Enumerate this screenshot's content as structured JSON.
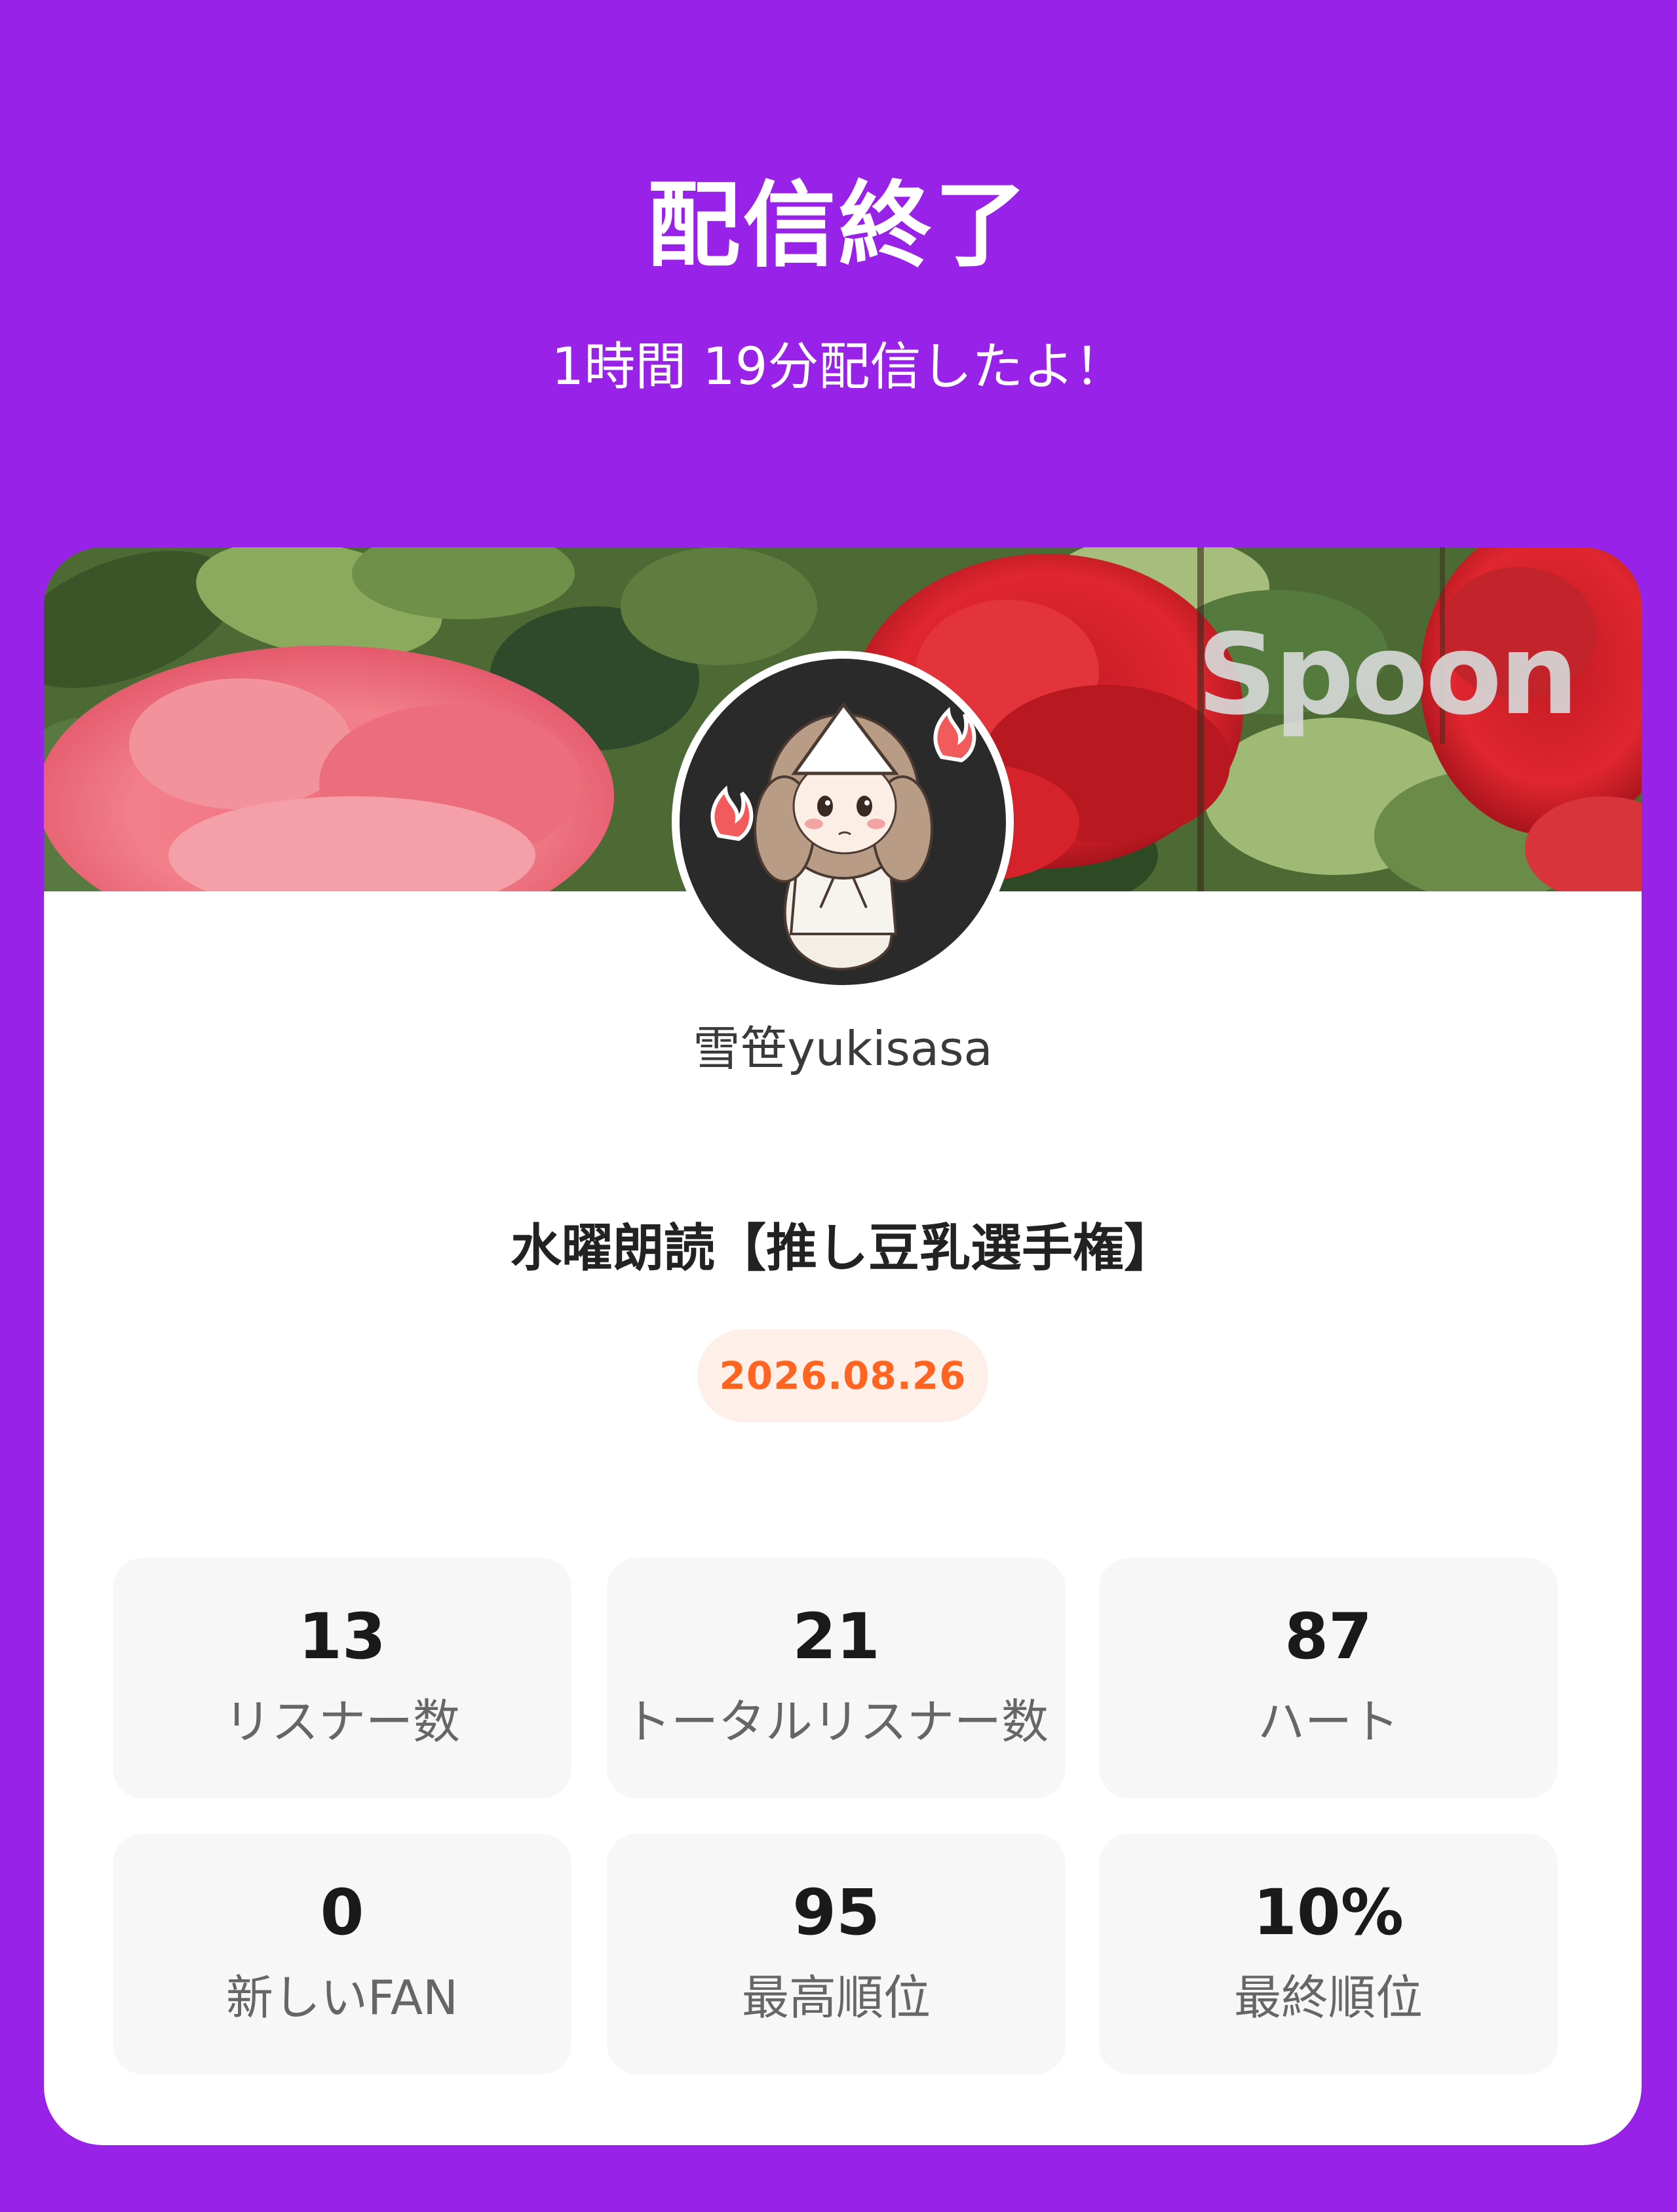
{
  "header": {
    "title": "配信終了",
    "subtitle": "1時間 19分配信したよ！"
  },
  "card": {
    "brand_logo": "Spoon",
    "avatar_icon": "ghost-girl-avatar-icon",
    "username": "雪笹yukisasa",
    "live_title": "水曜朗読【推し豆乳選手権】",
    "date": "2026.08.26"
  },
  "stats": [
    {
      "value": "13",
      "label": "リスナー数"
    },
    {
      "value": "21",
      "label": "トータルリスナー数"
    },
    {
      "value": "87",
      "label": "ハート"
    },
    {
      "value": "0",
      "label": "新しいFAN"
    },
    {
      "value": "95",
      "label": "最高順位"
    },
    {
      "value": "10%",
      "label": "最終順位"
    }
  ],
  "colors": {
    "background": "#9922e8",
    "card": "#ffffff",
    "date_text": "#ff6420",
    "date_badge": "#feefe8",
    "stat_box": "#f7f7f7"
  }
}
